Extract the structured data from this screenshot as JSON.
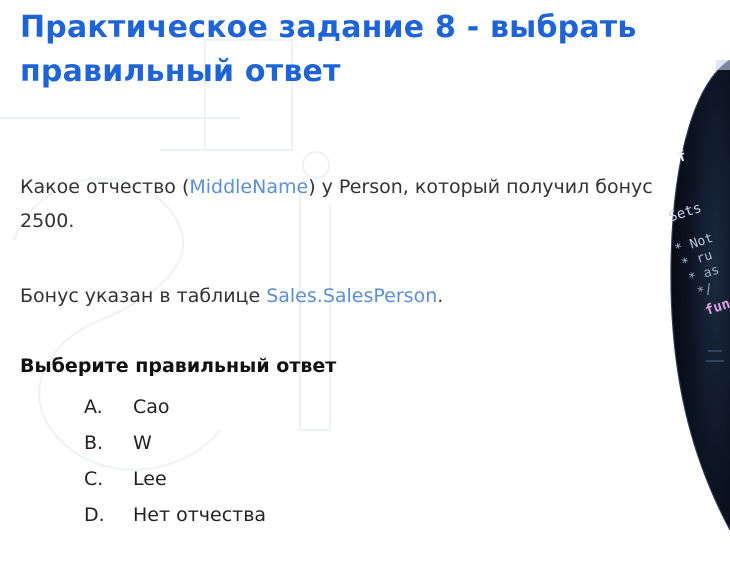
{
  "slide": {
    "title_line1": "Практическое задание 8 - выбрать",
    "title_line2": "правильный ответ",
    "question": {
      "before": "Какое отчество (",
      "highlight": "MiddleName",
      "after": ") у Person, который получил бонус 2500."
    },
    "hint": {
      "before": "Бонус указан в таблице ",
      "highlight": "Sales.SalesPerson",
      "after": "."
    },
    "answer_heading": "Выберите правильный ответ",
    "options": [
      {
        "letter": "A.",
        "text": "Cao"
      },
      {
        "letter": "B.",
        "text": "W"
      },
      {
        "letter": "C.",
        "text": "Lee"
      },
      {
        "letter": "D.",
        "text": "Нет отчества"
      }
    ]
  },
  "code_photo": {
    "lines": [
      "! f",
      "Sets",
      "* Not",
      "* ru",
      "* as",
      "*/",
      "func"
    ]
  },
  "colors": {
    "title": "#1e64d6",
    "link": "#5b8fd8",
    "text": "#333333",
    "photo_bg": "#0b1220"
  }
}
